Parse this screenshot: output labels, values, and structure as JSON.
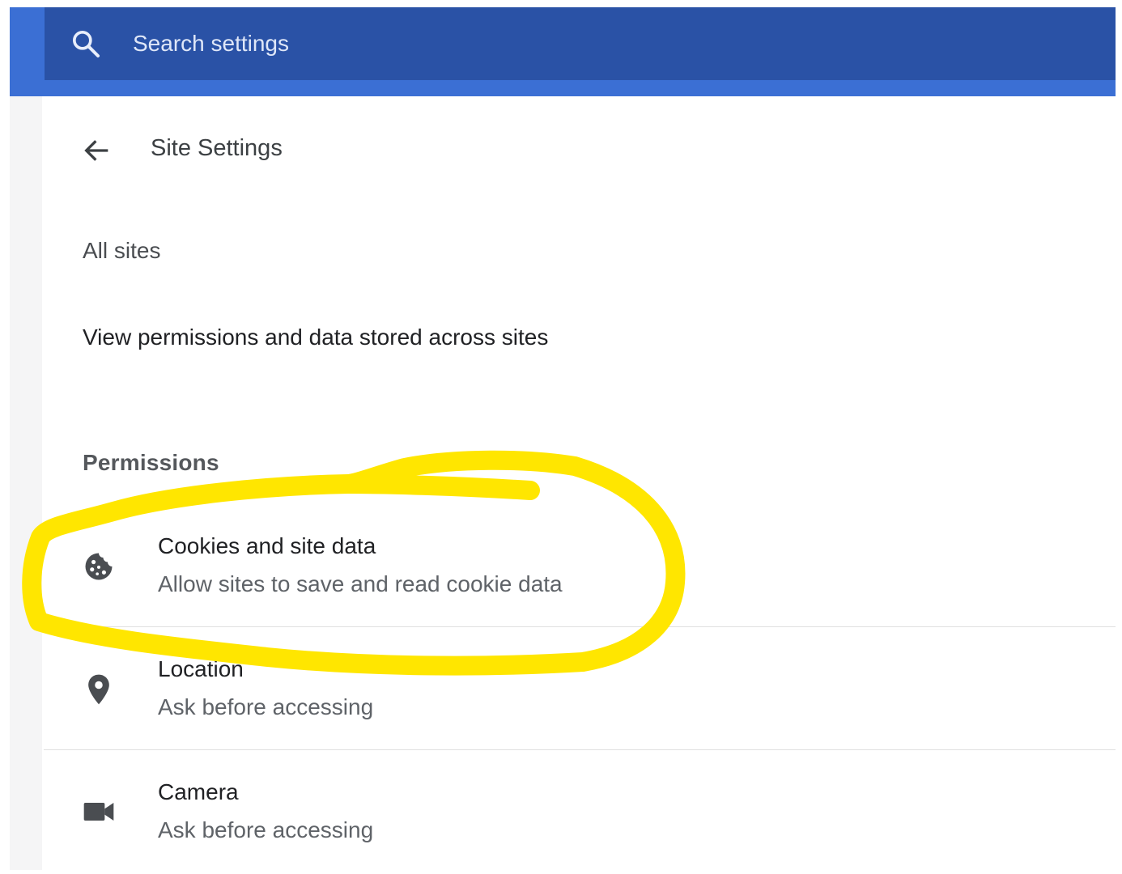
{
  "search": {
    "placeholder": "Search settings"
  },
  "header": {
    "title": "Site Settings"
  },
  "all_sites": {
    "label": "All sites",
    "description": "View permissions and data stored across sites"
  },
  "permissions": {
    "heading": "Permissions",
    "items": [
      {
        "title": "Cookies and site data",
        "subtitle": "Allow sites to save and read cookie data",
        "icon": "cookie-icon"
      },
      {
        "title": "Location",
        "subtitle": "Ask before accessing",
        "icon": "location-pin-icon"
      },
      {
        "title": "Camera",
        "subtitle": "Ask before accessing",
        "icon": "camera-icon"
      }
    ]
  },
  "colors": {
    "search_bar": "#2a52a6",
    "accent_blue": "#3b6fd4",
    "highlight": "#ffe600",
    "icon": "#4a4d51"
  }
}
